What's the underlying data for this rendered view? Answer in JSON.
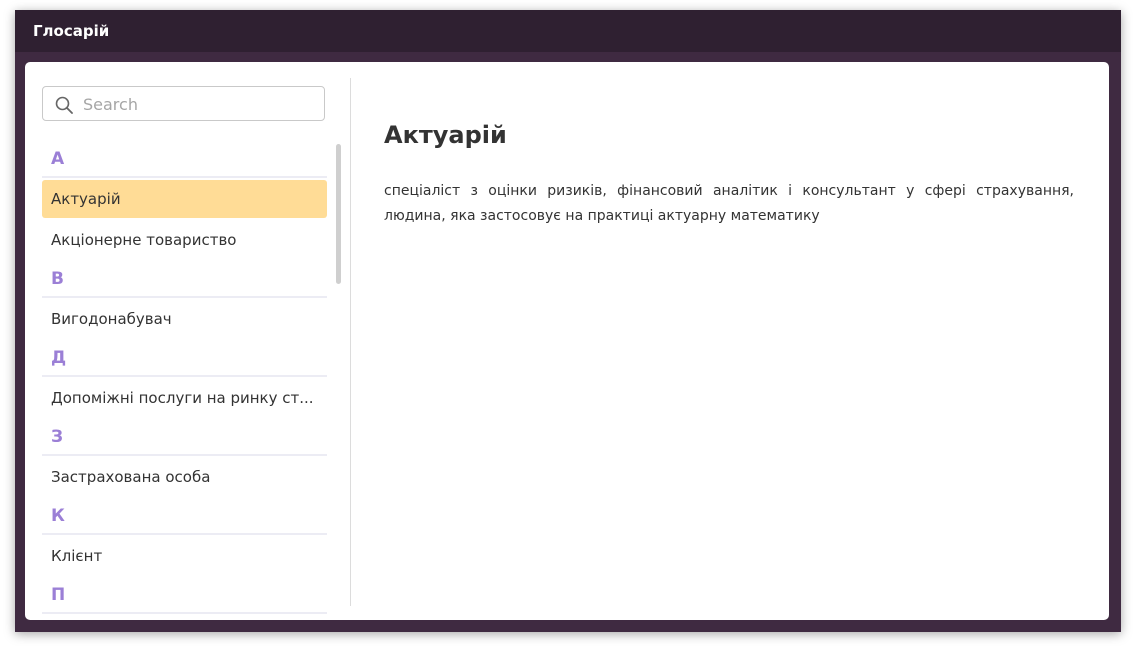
{
  "window": {
    "title": "Глосарій"
  },
  "search": {
    "placeholder": "Search",
    "icon": "search-icon"
  },
  "glossary": {
    "groups": [
      {
        "letter": "А",
        "items": [
          "Актуарій",
          "Акціонерне товариство"
        ]
      },
      {
        "letter": "В",
        "items": [
          "Вигодонабувач"
        ]
      },
      {
        "letter": "Д",
        "items": [
          "Допоміжні послуги на ринку ст..."
        ]
      },
      {
        "letter": "З",
        "items": [
          "Застрахована особа"
        ]
      },
      {
        "letter": "К",
        "items": [
          "Клієнт"
        ]
      },
      {
        "letter": "П",
        "items": []
      }
    ],
    "selected": "Актуарій"
  },
  "detail": {
    "term": "Актуарій",
    "definition": "спеціаліст з оцінки ризиків, фінансовий аналітик і консультант у сфері страхування, людина, яка застосовує на практиці актуарну математику"
  },
  "colors": {
    "titlebar": "#2f2031",
    "frame": "#3f2a41",
    "letter": "#9b7fd6",
    "selected": "#ffdc96"
  }
}
